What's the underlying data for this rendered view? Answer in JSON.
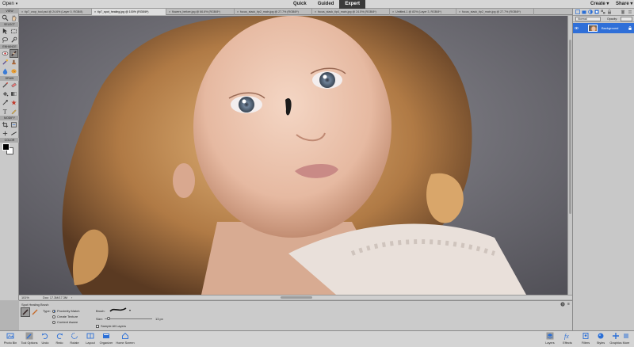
{
  "topbar": {
    "open_label": "Open",
    "mode_tabs": [
      "Quick",
      "Guided",
      "Expert"
    ],
    "active_mode": "Expert",
    "create_label": "Create",
    "share_label": "Share"
  },
  "doc_tabs": [
    "tip7_crop_tool.psd @ 24.6% (Layer 0, RGB/8)",
    "tip7_spot_healing.jpg @ 100% (RGB/8*)",
    "flowers_before.jpg @ 66.6% (RGB/8*)",
    "focus_stack_tip2_main.jpg @ 27.7% (RGB/8*)",
    "focus_stack_tip4_main.jpg @ 24.5% (RGB/8*)",
    "Untitled-1 @ 83% (Layer 3, RGB/8*)",
    "focus_stack_tip2_main.jpg @ 27.7% (RGB/8*)"
  ],
  "toolbar": {
    "sections": [
      "VIEW",
      "SELECT",
      "ENHANCE",
      "DRAW",
      "MODIFY",
      "COLOR"
    ],
    "colors": {
      "foreground": "#000000",
      "background": "#ffffff"
    }
  },
  "status": {
    "zoom": "101%",
    "doc_size": "Doc: 17.3M/17.3M",
    "arrow": "›"
  },
  "tool_options": {
    "tool_name": "Spot Healing Brush",
    "type_label": "Type:",
    "types": [
      "Proximity Match",
      "Create Texture",
      "Content Aware"
    ],
    "selected_type": "Proximity Match",
    "brush_label": "Brush:",
    "size_label": "Size:",
    "size_value": "13 px",
    "size_fraction": 0.05,
    "sample_all_layers": "Sample All Layers",
    "help": "?",
    "menu": "≡"
  },
  "taskbar": {
    "left": [
      {
        "label": "Photo Bin",
        "icon": "photo-bin-icon"
      },
      {
        "label": "Tool Options",
        "icon": "tool-options-icon"
      },
      {
        "label": "Undo",
        "icon": "undo-icon"
      },
      {
        "label": "Redo",
        "icon": "redo-icon"
      },
      {
        "label": "Rotate",
        "icon": "rotate-icon"
      },
      {
        "label": "Layout",
        "icon": "layout-icon"
      },
      {
        "label": "Organizer",
        "icon": "organizer-icon"
      },
      {
        "label": "Home Screen",
        "icon": "home-screen-icon"
      }
    ],
    "right": [
      {
        "label": "Layers",
        "icon": "layers-icon"
      },
      {
        "label": "Effects",
        "icon": "effects-icon"
      },
      {
        "label": "Filters",
        "icon": "filters-icon"
      },
      {
        "label": "Styles",
        "icon": "styles-icon"
      },
      {
        "label": "Graphics",
        "icon": "graphics-icon"
      },
      {
        "label": "More",
        "icon": "more-icon"
      }
    ]
  },
  "layers_panel": {
    "blend_mode": "Normal",
    "opacity_label": "Opacity:",
    "opacity_value": "",
    "layer_name": "Background"
  },
  "colors": {
    "accent": "#2f6fd8",
    "panel": "#c8c8c8",
    "active_tab": "#3a3a3a"
  }
}
